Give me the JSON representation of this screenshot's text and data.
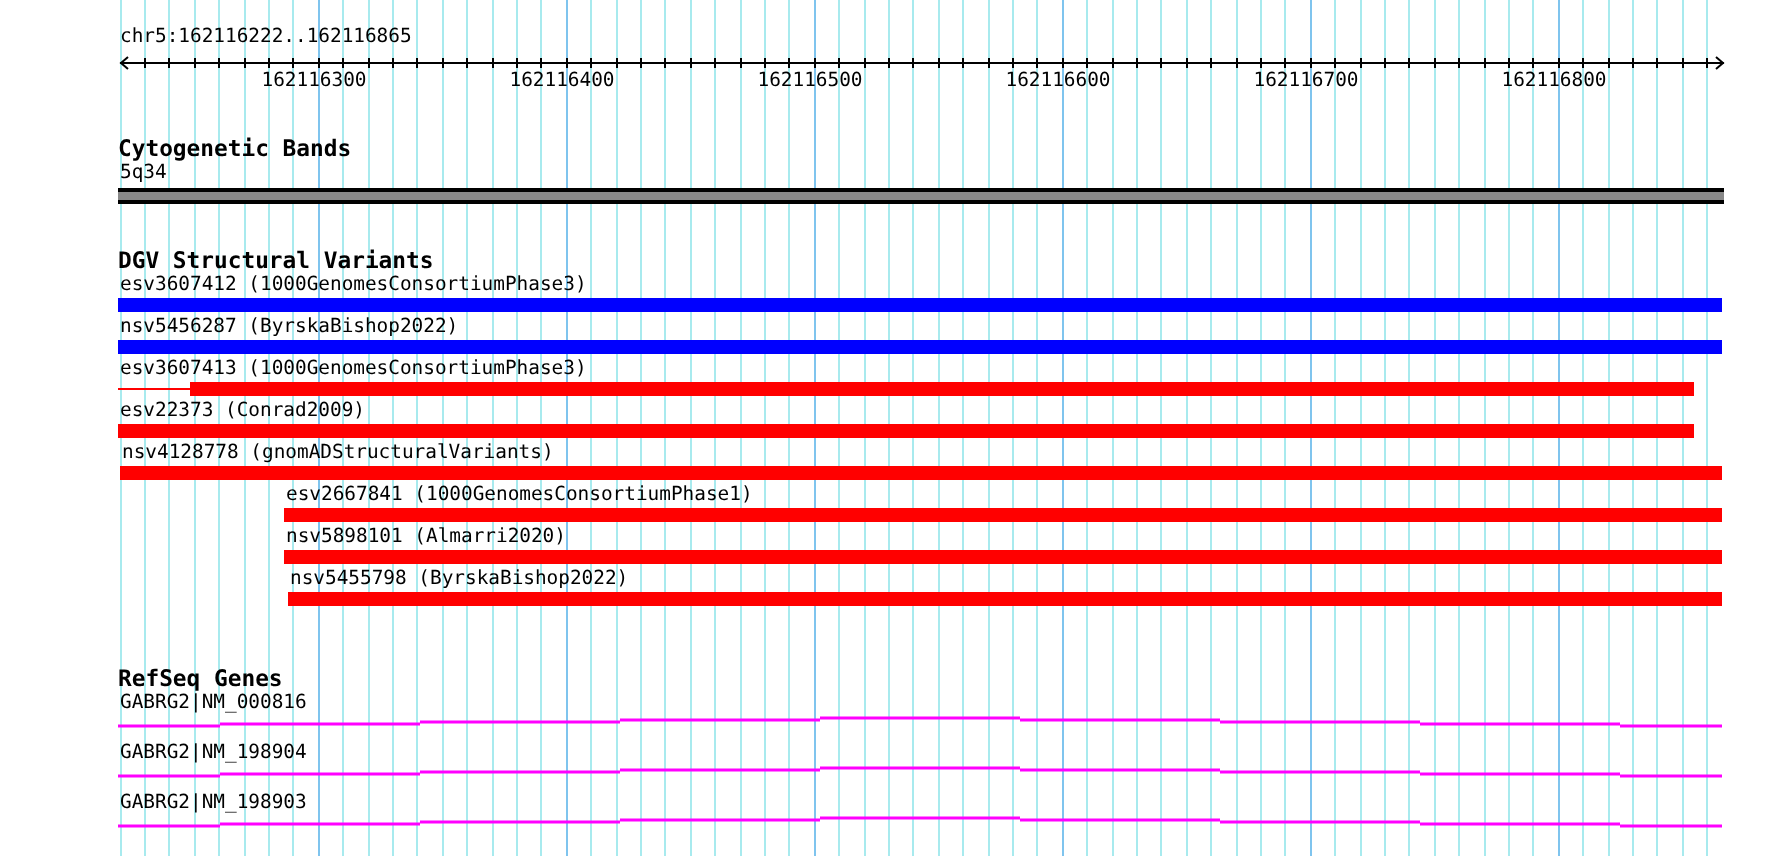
{
  "ruler": {
    "range": "chr5:162116222..162116865",
    "ticks": [
      "162116300",
      "162116400",
      "162116500",
      "162116600",
      "162116700",
      "162116800"
    ]
  },
  "tracks": [
    {
      "kind": "cytoband",
      "title": "Cytogenetic Bands",
      "features": [
        {
          "label": "5q34"
        }
      ]
    },
    {
      "kind": "variants",
      "title": "DGV Structural Variants",
      "features": [
        {
          "label": "esv3607412 (1000GenomesConsortiumPhase3)",
          "color": "#0000ff"
        },
        {
          "label": "nsv5456287 (ByrskaBishop2022)",
          "color": "#0000ff"
        },
        {
          "label": "esv3607413 (1000GenomesConsortiumPhase3)",
          "color": "#ff0000"
        },
        {
          "label": "esv22373 (Conrad2009)",
          "color": "#ff0000"
        },
        {
          "label": "nsv4128778 (gnomADStructuralVariants)",
          "color": "#ff0000"
        },
        {
          "label": "esv2667841 (1000GenomesConsortiumPhase1)",
          "color": "#ff0000"
        },
        {
          "label": "nsv5898101 (Almarri2020)",
          "color": "#ff0000"
        },
        {
          "label": "nsv5455798 (ByrskaBishop2022)",
          "color": "#ff0000"
        }
      ]
    },
    {
      "kind": "genes",
      "title": "RefSeq Genes",
      "features": [
        {
          "label": "GABRG2|NM_000816"
        },
        {
          "label": "GABRG2|NM_198904"
        },
        {
          "label": "GABRG2|NM_198903"
        }
      ]
    }
  ]
}
